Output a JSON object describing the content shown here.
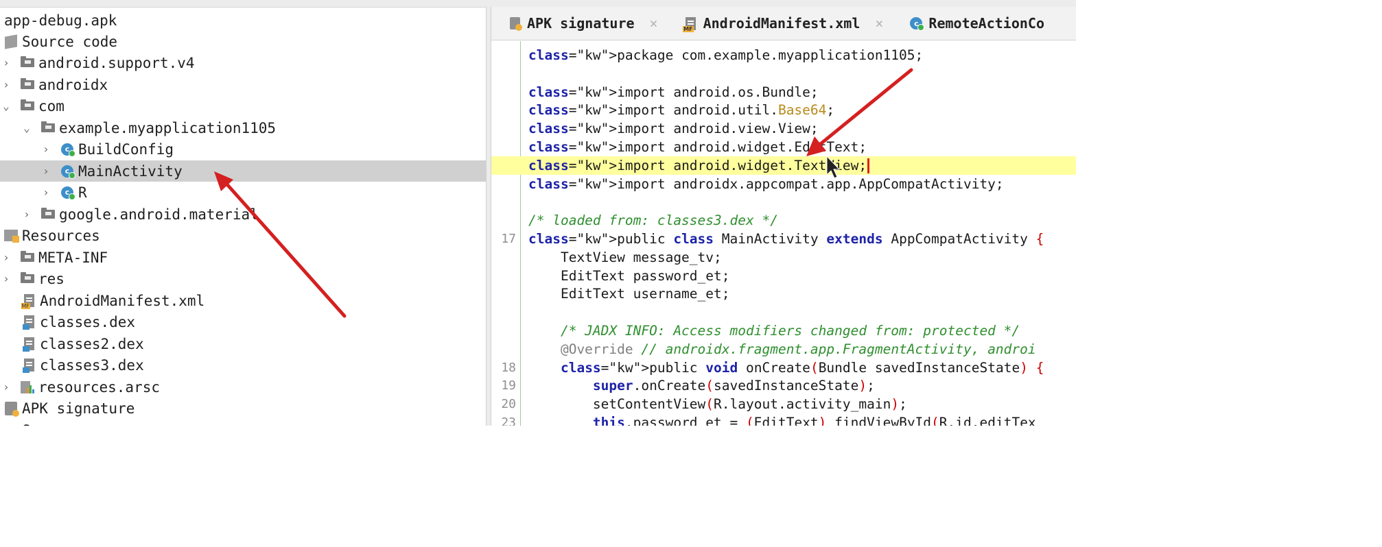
{
  "tree": {
    "items": [
      {
        "label": "app-debug.apk",
        "icon": "none",
        "chevron": ""
      },
      {
        "label": "Source code",
        "icon": "source-icon",
        "chevron": ""
      },
      {
        "label": "android.support.v4",
        "icon": "package-icon",
        "chevron": ">"
      },
      {
        "label": "androidx",
        "icon": "package-icon",
        "chevron": ">"
      },
      {
        "label": "com",
        "icon": "package-icon",
        "chevron": "v"
      },
      {
        "label": "example.myapplication1105",
        "icon": "package-icon",
        "chevron": "v"
      },
      {
        "label": "BuildConfig",
        "icon": "class-icon",
        "chevron": ">"
      },
      {
        "label": "MainActivity",
        "icon": "class-icon",
        "chevron": ">"
      },
      {
        "label": "R",
        "icon": "class-icon",
        "chevron": ">"
      },
      {
        "label": "google.android.material",
        "icon": "package-icon",
        "chevron": ">"
      },
      {
        "label": "Resources",
        "icon": "resources-icon",
        "chevron": ""
      },
      {
        "label": "META-INF",
        "icon": "folder-icon",
        "chevron": ">"
      },
      {
        "label": "res",
        "icon": "folder-icon",
        "chevron": ">"
      },
      {
        "label": "AndroidManifest.xml",
        "icon": "manifest-file-icon",
        "chevron": ""
      },
      {
        "label": "classes.dex",
        "icon": "dex-file-icon",
        "chevron": ""
      },
      {
        "label": "classes2.dex",
        "icon": "dex-file-icon",
        "chevron": ""
      },
      {
        "label": "classes3.dex",
        "icon": "dex-file-icon",
        "chevron": ""
      },
      {
        "label": "resources.arsc",
        "icon": "arsc-file-icon",
        "chevron": ">"
      },
      {
        "label": "APK signature",
        "icon": "signature-icon",
        "chevron": ""
      },
      {
        "label": "S",
        "icon": "summary-icon",
        "chevron": ""
      }
    ],
    "selected": "MainActivity"
  },
  "tabs": [
    {
      "label": "APK signature",
      "icon": "signature-icon",
      "close": "×"
    },
    {
      "label": "AndroidManifest.xml",
      "icon": "manifest-file-icon",
      "close": "×"
    },
    {
      "label": "RemoteActionCo",
      "icon": "class-icon",
      "close": ""
    }
  ],
  "editor": {
    "lines": [
      {
        "ln": "",
        "text": "package com.example.myapplication1105;"
      },
      {
        "ln": "",
        "text": ""
      },
      {
        "ln": "",
        "text": "import android.os.Bundle;"
      },
      {
        "ln": "",
        "text": "import android.util.Base64;"
      },
      {
        "ln": "",
        "text": "import android.view.View;"
      },
      {
        "ln": "",
        "text": "import android.widget.EditText;"
      },
      {
        "ln": "",
        "text": "import android.widget.TextView;"
      },
      {
        "ln": "",
        "text": "import androidx.appcompat.app.AppCompatActivity;"
      },
      {
        "ln": "",
        "text": ""
      },
      {
        "ln": "",
        "text": "/* loaded from: classes3.dex */"
      },
      {
        "ln": "17",
        "text": "public class MainActivity extends AppCompatActivity {"
      },
      {
        "ln": "",
        "text": "    TextView message_tv;"
      },
      {
        "ln": "",
        "text": "    EditText password_et;"
      },
      {
        "ln": "",
        "text": "    EditText username_et;"
      },
      {
        "ln": "",
        "text": ""
      },
      {
        "ln": "",
        "text": "    /* JADX INFO: Access modifiers changed from: protected */"
      },
      {
        "ln": "",
        "text": "    @Override // androidx.fragment.app.FragmentActivity, androi"
      },
      {
        "ln": "18",
        "text": "    public void onCreate(Bundle savedInstanceState) {"
      },
      {
        "ln": "19",
        "text": "        super.onCreate(savedInstanceState);"
      },
      {
        "ln": "20",
        "text": "        setContentView(R.layout.activity_main);"
      },
      {
        "ln": "23",
        "text": "        this.password_et = (EditText) findViewById(R.id.editTex"
      }
    ],
    "highlighted_line": 6
  },
  "colors": {
    "keyword": "#1d23a8",
    "comment": "#2f8f2f",
    "highlight_line": "#ffff9e",
    "selection": "#d0d0d0",
    "arrow": "#d42020"
  }
}
